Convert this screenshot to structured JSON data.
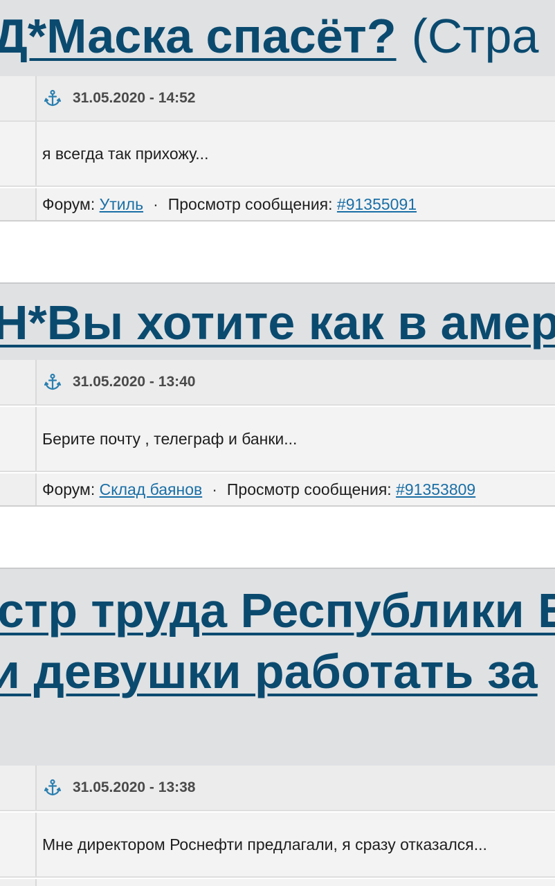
{
  "posts": [
    {
      "topic_lines": [
        "Д*Маска спасёт?"
      ],
      "topic_suffix": "(Стра",
      "date": "31.05.2020 - 14:52",
      "message": "я всегда так прихожу...",
      "forum_label": "Форум:",
      "forum_name": "Утиль",
      "view_label": "Просмотр сообщения:",
      "post_id": "#91355091"
    },
    {
      "topic_lines": [
        "Н*Вы хотите как в амер"
      ],
      "topic_suffix": "",
      "date": "31.05.2020 - 13:40",
      "message": "Берите почту , телеграф и банки...",
      "forum_label": "Форум:",
      "forum_name": "Склад баянов",
      "view_label": "Просмотр сообщения:",
      "post_id": "#91353809"
    },
    {
      "topic_lines": [
        "стр труда Республики Б",
        "и девушки работать за"
      ],
      "topic_suffix": "",
      "date": "31.05.2020 - 13:38",
      "message": "Мне директором Роснефти предлагали, я сразу отказался...",
      "forum_label": "",
      "forum_name": "",
      "view_label": "",
      "post_id": ""
    }
  ],
  "separator": "·",
  "colors": {
    "link_title": "#0b4a6f",
    "link_small": "#1a6fa6",
    "anchor_icon": "#2a7fb0"
  },
  "icons": {
    "date_icon": "anchor-icon"
  }
}
